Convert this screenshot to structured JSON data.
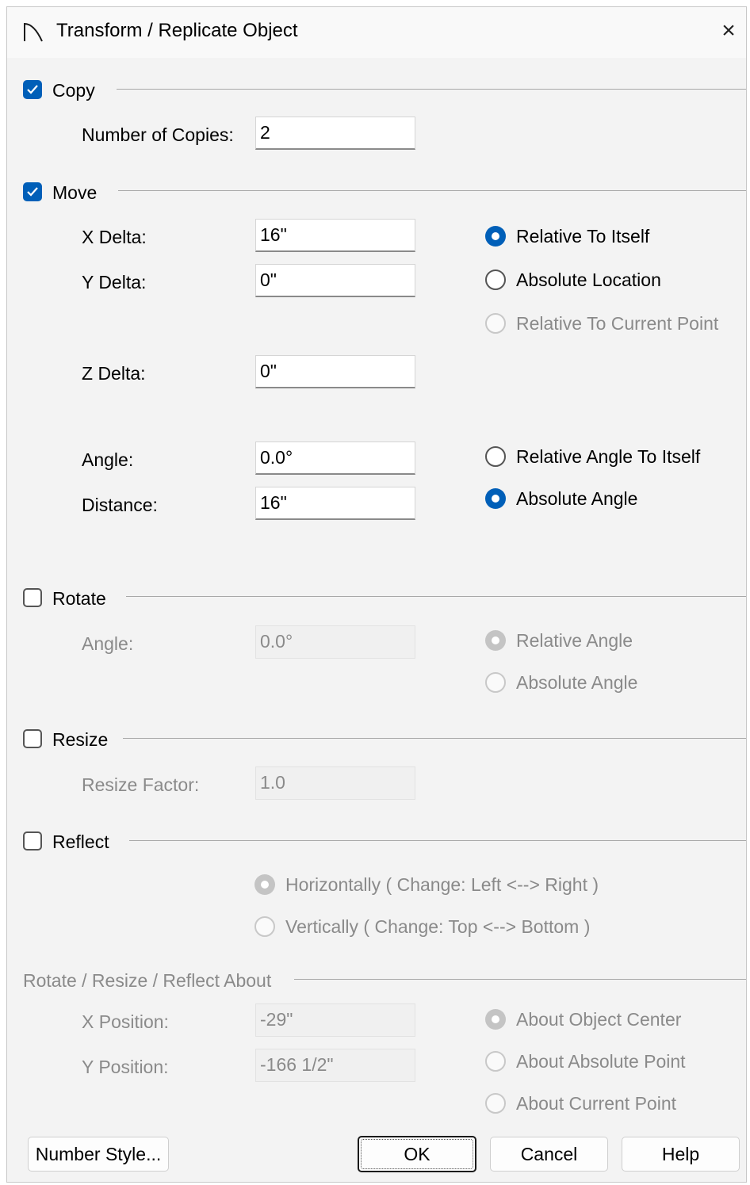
{
  "window": {
    "title": "Transform / Replicate Object",
    "close_glyph": "×",
    "icon": "arc-icon"
  },
  "copy": {
    "label": "Copy",
    "checked": true,
    "copies_label": "Number of Copies:",
    "copies_value": "2"
  },
  "move": {
    "label": "Move",
    "checked": true,
    "x_label": "X Delta:",
    "x_value": "16\"",
    "y_label": "Y Delta:",
    "y_value": "0\"",
    "z_label": "Z Delta:",
    "z_value": "0\"",
    "angle_label": "Angle:",
    "angle_value": "0.0°",
    "distance_label": "Distance:",
    "distance_value": "16\"",
    "mode_options": [
      "Relative To Itself",
      "Absolute Location",
      "Relative To Current Point"
    ],
    "mode_selected": "Relative To Itself",
    "angle_options": [
      "Relative Angle To Itself",
      "Absolute Angle"
    ],
    "angle_selected": "Absolute Angle"
  },
  "rotate": {
    "label": "Rotate",
    "checked": false,
    "angle_label": "Angle:",
    "angle_value": "0.0°",
    "options": [
      "Relative Angle",
      "Absolute Angle"
    ],
    "selected": "Relative Angle"
  },
  "resize": {
    "label": "Resize",
    "checked": false,
    "factor_label": "Resize Factor:",
    "factor_value": "1.0"
  },
  "reflect": {
    "label": "Reflect",
    "checked": false,
    "options": [
      "Horizontally ( Change: Left <--> Right )",
      "Vertically ( Change: Top <--> Bottom )"
    ],
    "selected": "Horizontally ( Change: Left <--> Right )"
  },
  "about": {
    "label": "Rotate / Resize / Reflect About",
    "x_label": "X Position:",
    "x_value": "-29\"",
    "y_label": "Y Position:",
    "y_value": "-166 1/2\"",
    "options": [
      "About Object Center",
      "About Absolute Point",
      "About Current Point"
    ],
    "selected": "About Object Center"
  },
  "buttons": {
    "number_style": "Number Style...",
    "ok": "OK",
    "cancel": "Cancel",
    "help": "Help"
  },
  "colors": {
    "accent": "#005fb8",
    "disabled_text": "#8a8a8a"
  }
}
